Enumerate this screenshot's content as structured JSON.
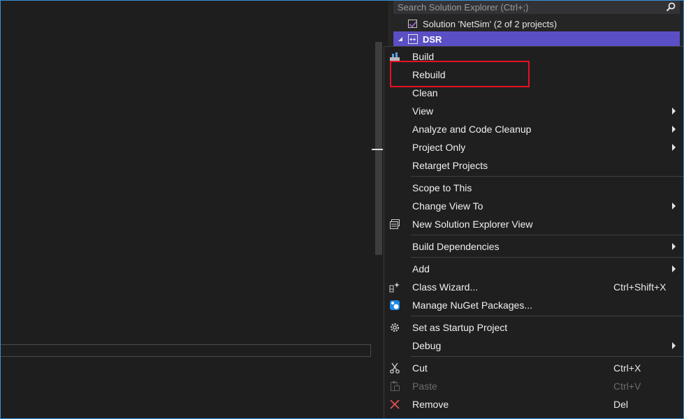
{
  "solution_explorer": {
    "search_placeholder": "Search Solution Explorer (Ctrl+;)",
    "solution_label": "Solution 'NetSim' (2 of 2 projects)",
    "project_label": "DSR"
  },
  "context_menu": {
    "build": "Build",
    "rebuild": "Rebuild",
    "clean": "Clean",
    "view": "View",
    "analyze": "Analyze and Code Cleanup",
    "project_only": "Project Only",
    "retarget": "Retarget Projects",
    "scope_to_this": "Scope to This",
    "change_view_to": "Change View To",
    "new_se_view": "New Solution Explorer View",
    "build_dependencies": "Build Dependencies",
    "add": "Add",
    "class_wizard": "Class Wizard...",
    "class_wizard_shortcut": "Ctrl+Shift+X",
    "manage_nuget": "Manage NuGet Packages...",
    "set_startup": "Set as Startup Project",
    "debug": "Debug",
    "cut": "Cut",
    "cut_shortcut": "Ctrl+X",
    "paste": "Paste",
    "paste_shortcut": "Ctrl+V",
    "remove": "Remove",
    "remove_shortcut": "Del"
  },
  "colors": {
    "accent_selection": "#5a4fc4",
    "highlight_box": "#e81123",
    "frame": "#3a8fd6"
  }
}
